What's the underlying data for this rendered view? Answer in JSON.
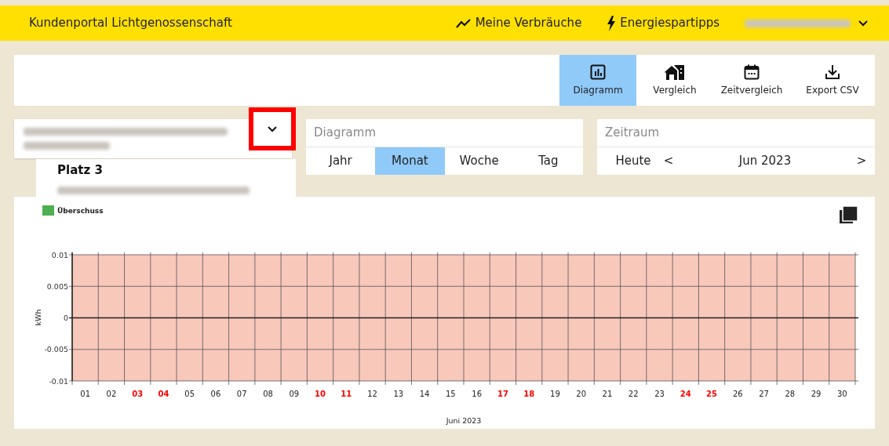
{
  "header": {
    "title": "Kundenportal Lichtgenossenschaft",
    "nav": [
      {
        "kind": "trend",
        "label": "Meine Verbräuche"
      },
      {
        "kind": "bolt",
        "label": "Energiespartipps"
      }
    ],
    "user_menu": {
      "redacted": true
    }
  },
  "toolbar": {
    "tabs": [
      {
        "kind": "chart",
        "label": "Diagramm",
        "selected": true
      },
      {
        "kind": "house",
        "label": "Vergleich",
        "selected": false
      },
      {
        "kind": "calendar",
        "label": "Zeitvergleich",
        "selected": false
      },
      {
        "kind": "download",
        "label": "Export CSV",
        "selected": false
      }
    ]
  },
  "plant_select": {
    "redacted": true,
    "highlighted": true,
    "option": {
      "title": "Platz 3",
      "redacted": true
    }
  },
  "diagram_panel": {
    "title": "Diagramm",
    "options": [
      {
        "label": "Jahr",
        "selected": false
      },
      {
        "label": "Monat",
        "selected": true
      },
      {
        "label": "Woche",
        "selected": false
      },
      {
        "label": "Tag",
        "selected": false
      }
    ]
  },
  "period_panel": {
    "title": "Zeitraum",
    "today": "Heute",
    "prev": "<",
    "period": "Jun 2023",
    "next": ">"
  },
  "chart": {
    "weekend": [
      false,
      false,
      true,
      true,
      false,
      false,
      false,
      false,
      false,
      true,
      true,
      false,
      false,
      false,
      false,
      false,
      true,
      true,
      false,
      false,
      false,
      false,
      false,
      true,
      true,
      false,
      false,
      false,
      false,
      false
    ],
    "chart_data": {
      "type": "bar",
      "xlabel": "Juni 2023",
      "ylabel": "kWh",
      "categories": [
        "01",
        "02",
        "03",
        "04",
        "05",
        "06",
        "07",
        "08",
        "09",
        "10",
        "11",
        "12",
        "13",
        "14",
        "15",
        "16",
        "17",
        "18",
        "19",
        "20",
        "21",
        "22",
        "23",
        "24",
        "25",
        "26",
        "27",
        "28",
        "29",
        "30"
      ],
      "ylim": [
        -0.01,
        0.01
      ],
      "yticks": [
        0.01,
        0.005,
        0,
        -0.005,
        -0.01
      ],
      "series": [
        {
          "name": "Überschuss",
          "color": "#4caf50",
          "values": [
            null,
            null,
            null,
            null,
            null,
            null,
            null,
            null,
            null,
            null,
            null,
            null,
            null,
            null,
            null,
            null,
            null,
            null,
            null,
            null,
            null,
            null,
            null,
            null,
            null,
            null,
            null,
            null,
            null,
            null
          ]
        }
      ]
    }
  }
}
